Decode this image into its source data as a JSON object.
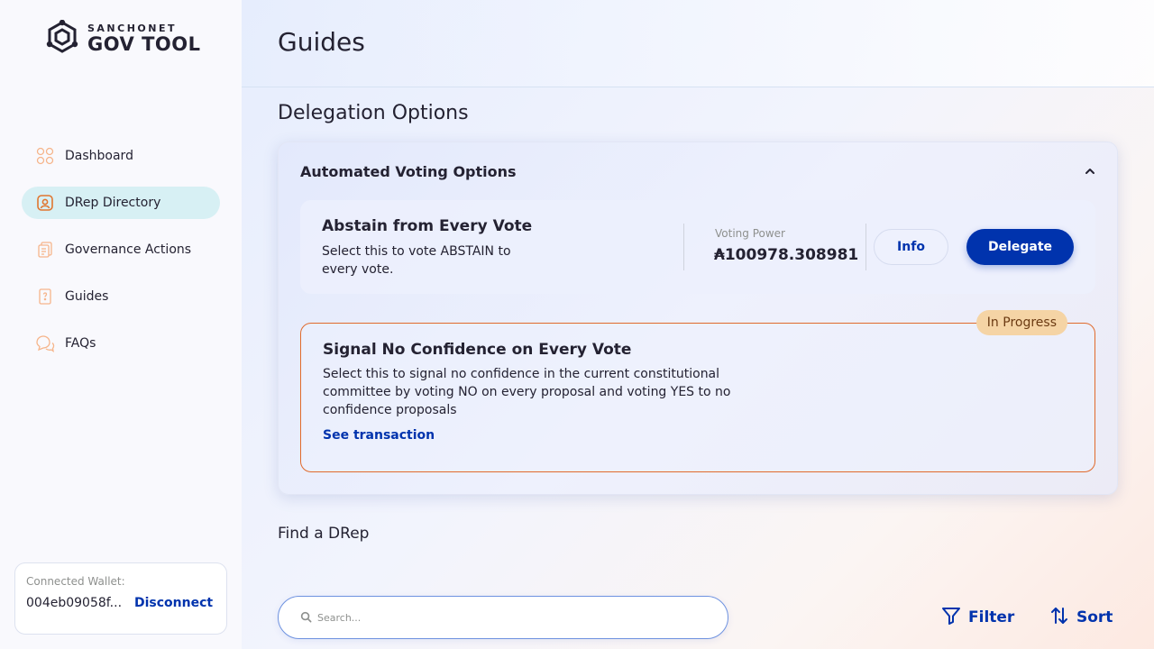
{
  "app": {
    "brand_small": "SANCHONET",
    "brand_big": "GOV TOOL"
  },
  "sidebar": {
    "items": [
      {
        "label": "Dashboard",
        "icon": "dashboard-icon",
        "active": false
      },
      {
        "label": "DRep Directory",
        "icon": "drep-directory-icon",
        "active": true
      },
      {
        "label": "Governance Actions",
        "icon": "governance-actions-icon",
        "active": false
      },
      {
        "label": "Guides",
        "icon": "guides-icon",
        "active": false
      },
      {
        "label": "FAQs",
        "icon": "faqs-icon",
        "active": false
      }
    ],
    "wallet": {
      "label": "Connected Wallet:",
      "address": "004eb09058f...",
      "disconnect": "Disconnect"
    }
  },
  "header": {
    "title": "Guides"
  },
  "delegation": {
    "title": "Delegation Options",
    "card_title": "Automated Voting Options",
    "abstain": {
      "title": "Abstain from Every Vote",
      "description": "Select this to vote ABSTAIN to every vote.",
      "voting_power_label": "Voting Power",
      "voting_power_value": "₳100978.308981",
      "info_label": "Info",
      "delegate_label": "Delegate"
    },
    "no_confidence": {
      "badge": "In Progress",
      "title": "Signal No Confidence on Every Vote",
      "description": "Select this to signal no confidence in the current constitutional committee by voting NO on every proposal and voting YES to no confidence proposals",
      "link": "See transaction"
    }
  },
  "find_drep": {
    "title": "Find a DRep",
    "search_placeholder": "Search...",
    "search_value": "",
    "filter_label": "Filter",
    "sort_label": "Sort"
  },
  "colors": {
    "primary": "#0033ad",
    "active_nav": "#d7f0f4",
    "in_progress_border": "#e06a2b",
    "badge_bg": "#f5d4a5",
    "nav_icon": "#f08a4b"
  }
}
